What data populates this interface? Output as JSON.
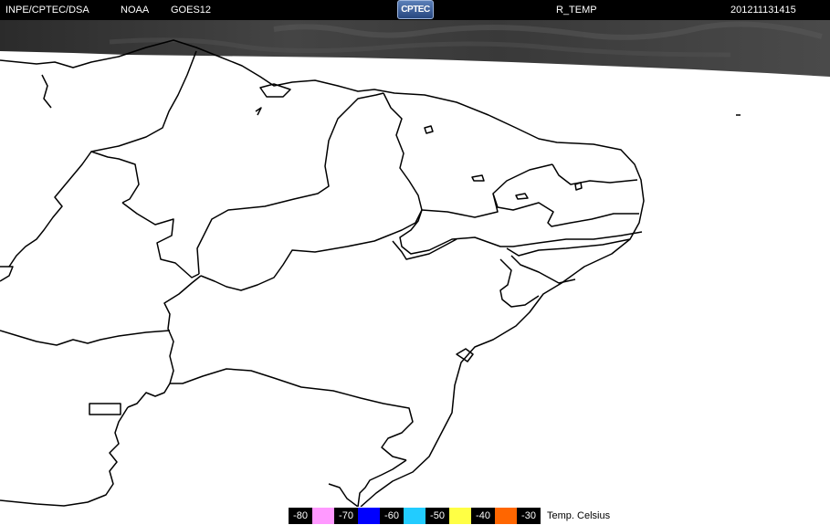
{
  "header": {
    "agency": "INPE/CPTEC/DSA",
    "source": "NOAA",
    "satellite": "GOES12",
    "logo_text": "CPTEC",
    "product": "R_TEMP",
    "timestamp": "201211131415"
  },
  "legend": {
    "unit_label": "Temp. Celsius",
    "steps": [
      {
        "label": "-80",
        "color": "#ff99ff"
      },
      {
        "label": "-70",
        "color": "#0000ff"
      },
      {
        "label": "-60",
        "color": "#22ccff"
      },
      {
        "label": "-50",
        "color": "#ffff44"
      },
      {
        "label": "-40",
        "color": "#ff6600"
      },
      {
        "label": "-30",
        "color": ""
      }
    ]
  },
  "colors": {
    "background": "#ffffff",
    "cloud_band": "#3a3a3a",
    "borders": "#000000"
  }
}
